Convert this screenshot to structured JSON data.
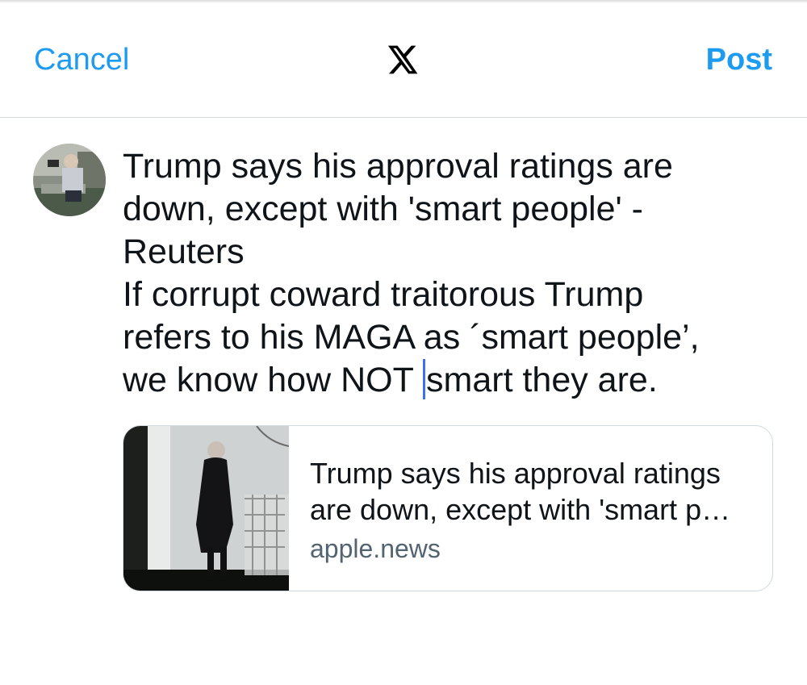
{
  "header": {
    "cancel_label": "Cancel",
    "post_label": "Post",
    "logo_icon": "x-logo-icon"
  },
  "composer": {
    "avatar_icon": "user-avatar",
    "text_before_caret": "Trump says his approval ratings are\ndown, except with 'smart people' -\nReuters\nIf corrupt coward traitorous Trump\nrefers to his MAGA as ´smart people’,\nwe know how NOT ",
    "text_after_caret": "smart they are."
  },
  "link_preview": {
    "title_line1": "Trump says his approval ratings",
    "title_line2": "are down, except with 'smart p…",
    "domain": "apple.news"
  },
  "colors": {
    "accent": "#1d9bf0",
    "caret": "#3b6ff5",
    "divider": "#cfd9de",
    "secondary_text": "#536471"
  }
}
